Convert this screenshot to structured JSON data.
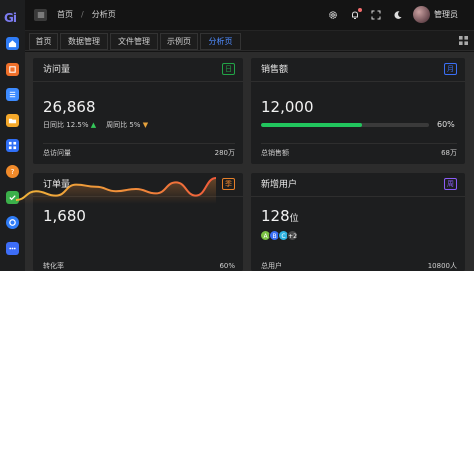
{
  "brand": {
    "logo_text": "Gi"
  },
  "header": {
    "breadcrumb": [
      "首页",
      "分析页"
    ],
    "breadcrumb_sep": "/",
    "user_name": "管理员"
  },
  "tabs": [
    {
      "label": "首页",
      "active": false
    },
    {
      "label": "数据管理",
      "active": false
    },
    {
      "label": "文件管理",
      "active": false
    },
    {
      "label": "示例页",
      "active": false
    },
    {
      "label": "分析页",
      "active": true
    }
  ],
  "sidebar": {
    "items": [
      {
        "icon": "home-icon",
        "color": "#2f7cf6"
      },
      {
        "icon": "grid-icon",
        "color": "#f0702a"
      },
      {
        "icon": "list-icon",
        "color": "#3d8bff"
      },
      {
        "icon": "folder-icon",
        "color": "#f4a82a"
      },
      {
        "icon": "apps-icon",
        "color": "#2f6ff6"
      },
      {
        "icon": "help-icon",
        "color": "#f08a2a"
      },
      {
        "icon": "check-icon",
        "color": "#3bb04a"
      },
      {
        "icon": "settings-icon",
        "color": "#2f7cf6"
      },
      {
        "icon": "more-icon",
        "color": "#3d6df6"
      }
    ]
  },
  "cards": {
    "visits": {
      "title": "访问量",
      "tag": "日",
      "tag_color": "#22a447",
      "value": "26,868",
      "day_label": "日同比",
      "day_value": "12.5%",
      "day_trend": "▲",
      "week_label": "周同比",
      "week_value": "5%",
      "week_trend": "▼",
      "foot_label": "总访问量",
      "foot_value": "280万"
    },
    "sales": {
      "title": "销售额",
      "tag": "月",
      "tag_color": "#3b6ff5",
      "value": "12,000",
      "progress": 0.6,
      "progress_label": "60%",
      "foot_label": "总销售额",
      "foot_value": "68万"
    },
    "orders": {
      "title": "订单量",
      "tag": "季",
      "tag_color": "#e6802a",
      "value": "1,680",
      "foot_label": "转化率",
      "foot_value": "60%"
    },
    "users": {
      "title": "新增用户",
      "tag": "周",
      "tag_color": "#8b5cf6",
      "value": "128",
      "unit": "位",
      "avatars": [
        {
          "letter": "A",
          "color": "#7ac143"
        },
        {
          "letter": "B",
          "color": "#3b6ff5"
        },
        {
          "letter": "C",
          "color": "#2fb3e0"
        },
        {
          "letter": "+2",
          "color": "#4a4a4a"
        }
      ],
      "foot_label": "总用户",
      "foot_value": "10800人"
    }
  },
  "chart_data": {
    "type": "area",
    "values": [
      2,
      6,
      4,
      9,
      8,
      6,
      7,
      5,
      10,
      4,
      12
    ]
  }
}
